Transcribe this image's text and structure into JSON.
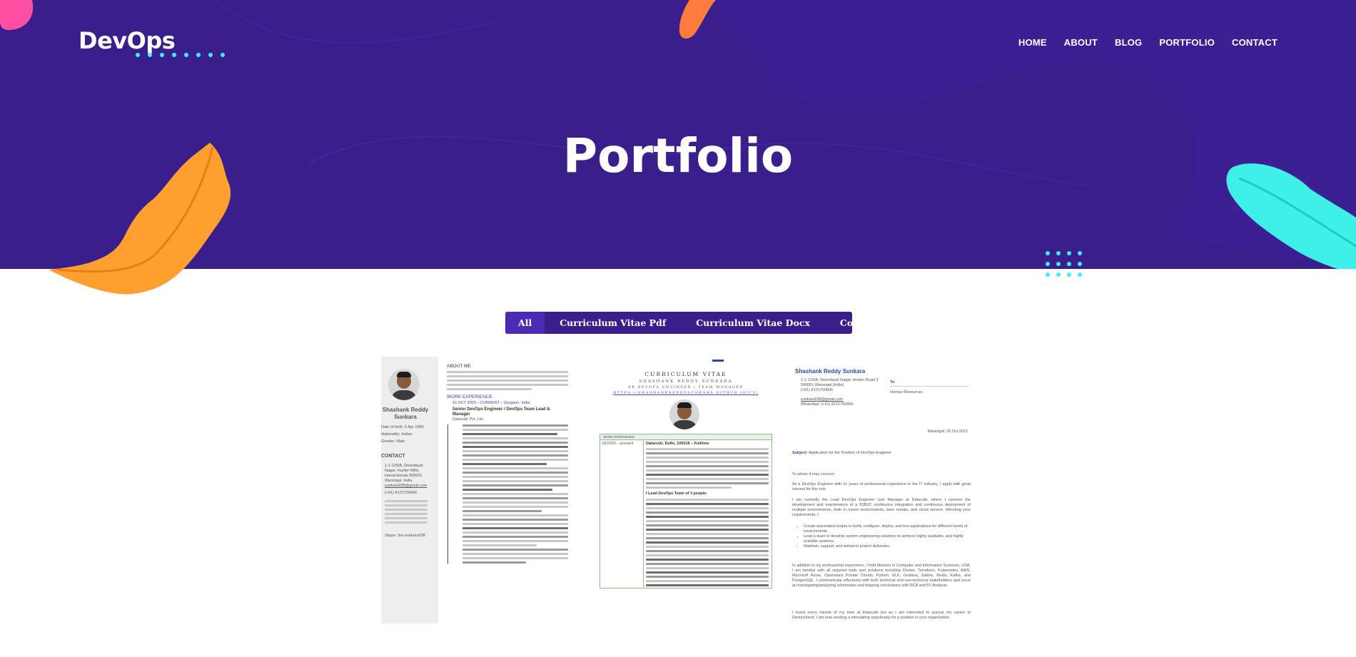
{
  "site": {
    "logo": "DevOps",
    "nav": [
      "HOME",
      "ABOUT",
      "BLOG",
      "PORTFOLIO",
      "CONTACT"
    ]
  },
  "page": {
    "title": "Portfolio"
  },
  "filters": {
    "items": [
      "All",
      "Curriculum Vitae Pdf",
      "Curriculum Vitae Docx",
      "Cover Letter"
    ],
    "active": "All"
  },
  "cards": {
    "cv_pdf": {
      "name": "Shashank Reddy Sunkara",
      "about_heading": "ABOUT ME",
      "work_heading": "WORK EXPERIENCE",
      "job_date": "15 OCT 2020 – CURRENT – Gurgaon, India",
      "job_title": "Senior DevOps Engineer / DevOps Team Lead & Manager",
      "company": "Datacultr Pvt. Ltd.",
      "contact_heading": "CONTACT",
      "birth": "Date of birth: 5 Apr 1994",
      "nationality": "Nationality: Indian",
      "gender": "Gender: Male",
      "address": "1-1-129/A, Deendayal Nagar, Hunter Wills, Hanamkonda 506001 Warangal, India",
      "email": "sunkara038@gmail.com",
      "phone": "(+91) 8121750666",
      "skype": "Skype: live:sunkara038"
    },
    "cv_docx": {
      "heading": "CURRICULUM VITAE",
      "name": "SHASHANK REDDY SUNKARA",
      "subtitle": "SR DEVOPS ENGINEER | TEAM MANAGER",
      "link": "HTTPS://SHASHANKREDDYSUNKARA.GITHUB.IO/CV/",
      "work_label": "WORK EXPERIENCE",
      "date": "10/2020 – present",
      "company": "Datacultr, Delhi, 100018 – Fulltime",
      "bullets_title": "I Lead DevOps Team of 3 people."
    },
    "cover": {
      "name": "Shashank Reddy Sunkara",
      "address": "1-1-129/A, Deendayal Nagar, Hunter Road 3",
      "city": "506001 Warangal (India)",
      "phone": "(+91) 8121750666",
      "email": "sunkara038@gmail.com",
      "whatsapp": "WhatsApp: (+91) 8121750666",
      "to_label": "To",
      "to_value": "Human Resources",
      "date": "Warangal, 26 Oct 2021",
      "subject_label": "Subject:",
      "subject": "Application for the Position of DevOps Engineer",
      "greeting": "To whom it may concern",
      "p1": "As a DevOps Engineer with 3+ years of professional experience in the IT industry, I apply with great interest for this role.",
      "p2": "I am currently the Lead DevOps Engineer cum Manager at Datacultr, where I oversee the development and maintenance of a B2B2C continuous integration and continuous deployment of multiple environments, both in mixed environments, bare metals, and cloud servers. Mirroring your requirements, I:",
      "bullets": [
        "Create automated scripts to build, configure, deploy, and test applications for different levels of environments.",
        "Lead a team to develop system engineering solutions to achieve highly available, and highly scalable systems.",
        "Maintain, support, and enhance project deliveries."
      ],
      "p3": "In addition to my professional experience, I hold Masters in Computer and Information Sciences, USA. I am familiar with all required tools and solutions including Docker, Terraform, Kubernetes, AWS, Microsoft Azure, Openstack Private Clouds, Python, ELK, Grafana, Zabbix, Redis, Kafka, and PostgreSQL. I communicate effectively with both technical and non-technical stakeholders and excel at investigating/analyzing information and drawing conclusions with RCA and 5Y Analysis.",
      "p4": "I loved every minute of my time at Datacultr but as I am interested to pursue my career in Deutschland, I am now seeking a stimulating opportunity for a position in your organization."
    }
  },
  "colors": {
    "hero_bg": "#3a1e8c",
    "filter_active": "#4b2bb3",
    "leaf_orange": "#ff9f30",
    "leaf_cyan": "#3ef0e8",
    "leaf_pink": "#ff4fa3",
    "dots": "#3ef0f5"
  }
}
